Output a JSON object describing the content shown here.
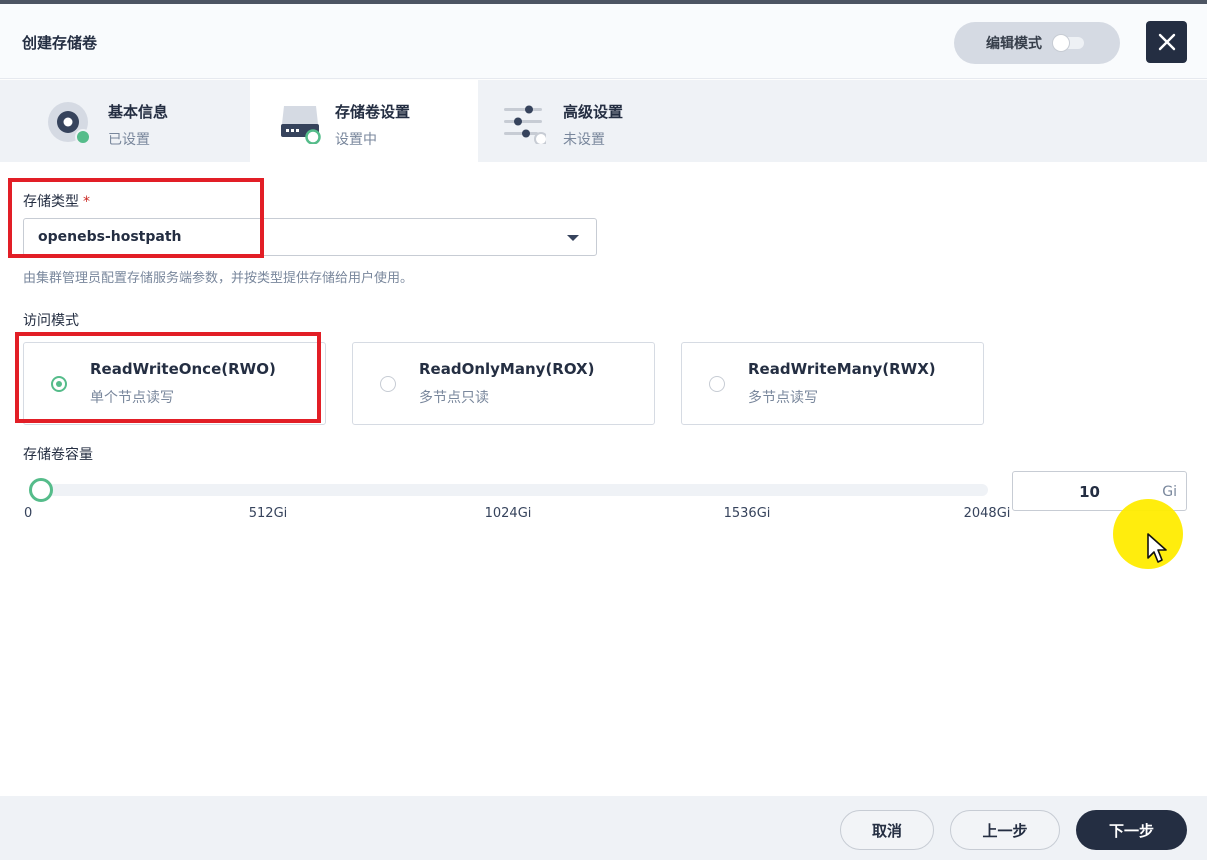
{
  "dialog": {
    "title": "创建存储卷",
    "edit_mode_label": "编辑模式"
  },
  "tabs": [
    {
      "name": "基本信息",
      "status": "已设置"
    },
    {
      "name": "存储卷设置",
      "status": "设置中"
    },
    {
      "name": "高级设置",
      "status": "未设置"
    }
  ],
  "storage_type": {
    "label": "存储类型",
    "required_mark": "*",
    "value": "openebs-hostpath",
    "help": "由集群管理员配置存储服务端参数，并按类型提供存储给用户使用。"
  },
  "access_mode": {
    "label": "访问模式",
    "options": [
      {
        "title": "ReadWriteOnce(RWO)",
        "desc": "单个节点读写",
        "selected": true
      },
      {
        "title": "ReadOnlyMany(ROX)",
        "desc": "多节点只读",
        "selected": false
      },
      {
        "title": "ReadWriteMany(RWX)",
        "desc": "多节点读写",
        "selected": false
      }
    ]
  },
  "capacity": {
    "label": "存储卷容量",
    "value": "10",
    "unit": "Gi",
    "min": 0,
    "max": 2048,
    "ticks": [
      "0",
      "512Gi",
      "1024Gi",
      "1536Gi",
      "2048Gi"
    ]
  },
  "footer": {
    "cancel": "取消",
    "prev": "上一步",
    "next": "下一步"
  },
  "colors": {
    "accent": "#55bc8a",
    "dark": "#242e42",
    "highlight_box": "#e21e26"
  }
}
